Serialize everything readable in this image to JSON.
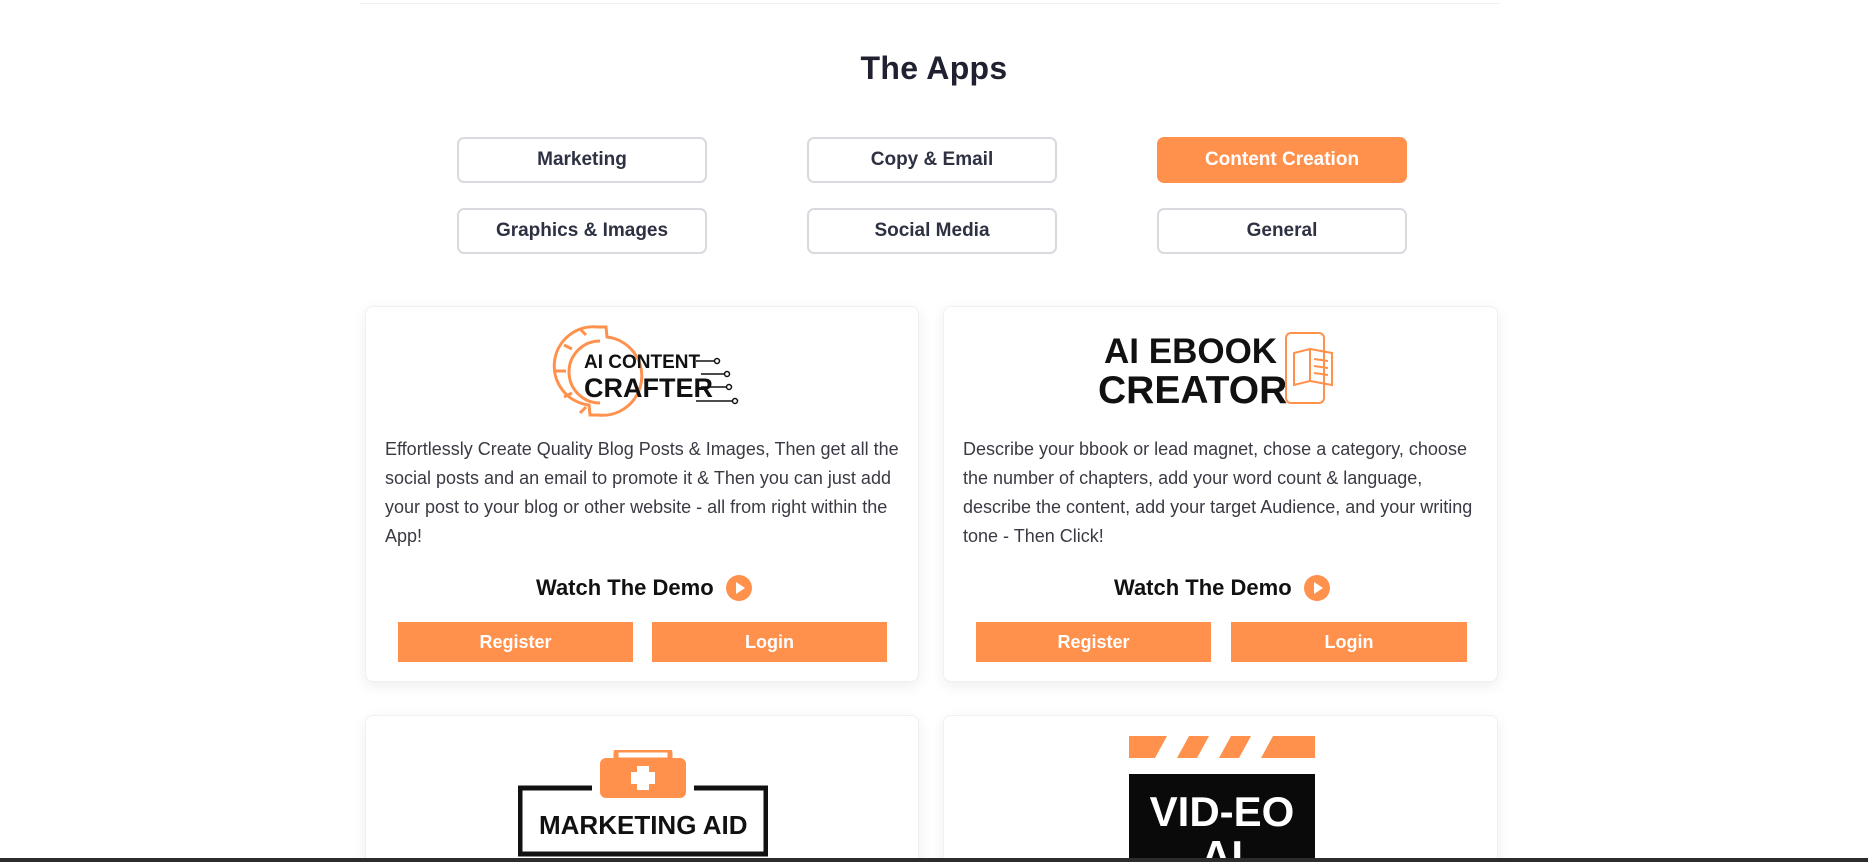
{
  "section": {
    "title": "The Apps"
  },
  "filters": [
    {
      "label": "Marketing",
      "active": false
    },
    {
      "label": "Copy & Email",
      "active": false
    },
    {
      "label": "Content Creation",
      "active": true
    },
    {
      "label": "Graphics & Images",
      "active": false
    },
    {
      "label": "Social Media",
      "active": false
    },
    {
      "label": "General",
      "active": false
    }
  ],
  "apps": [
    {
      "logo_line1": "AI CONTENT",
      "logo_line2": "CRAFTER",
      "description": "Effortlessly Create Quality Blog Posts & Images, Then get all the social posts and an email to promote it & Then you can just add your post to your blog or other website - all from right within the App!",
      "demo_label": "Watch The Demo",
      "register_label": "Register",
      "login_label": "Login"
    },
    {
      "logo_line1": "AI EBOOK",
      "logo_line2": "CREATOR",
      "description": "Describe your bbook or lead magnet, chose a category, choose the number of chapters, add your word count & language, describe the content, add your target Audience, and your writing tone - Then Click!",
      "demo_label": "Watch The Demo",
      "register_label": "Register",
      "login_label": "Login"
    },
    {
      "logo_text": "MARKETING AID"
    },
    {
      "logo_line1": "VID-EO",
      "logo_line2": "AI"
    }
  ],
  "colors": {
    "accent": "#ff914d",
    "text": "#2d3142",
    "border": "#d9dadf"
  }
}
